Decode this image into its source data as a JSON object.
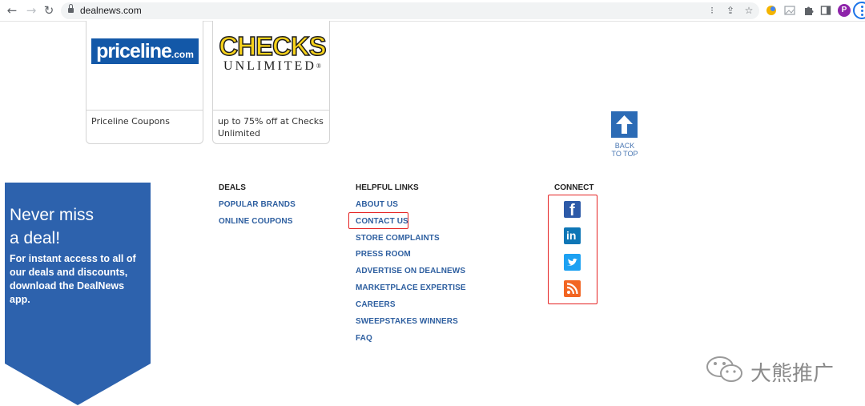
{
  "browser": {
    "url": "dealnews.com",
    "profile_initial": "P",
    "icons": [
      "back-icon",
      "forward-icon",
      "reload-icon",
      "lock-icon",
      "translate-icon",
      "share-icon",
      "bookmark-star-icon",
      "extension-icon",
      "puzzle-icon",
      "sidebar-icon",
      "kebab-menu-icon"
    ]
  },
  "cards": [
    {
      "logo": "priceline",
      "logo_main": "priceline",
      "logo_suffix": ".com",
      "caption": "Priceline Coupons"
    },
    {
      "logo": "checks",
      "logo_top": "CHECKS",
      "logo_bottom": "UNLIMITED",
      "logo_mark": "®",
      "caption": "up to 75% off at Checks Unlimited"
    }
  ],
  "back_to_top": {
    "label_line1": "BACK",
    "label_line2": "TO TOP"
  },
  "banner": {
    "title_line1": "Never miss",
    "title_line2": "a deal!",
    "subtitle": "For instant access to all of our deals and discounts, download the DealNews app.",
    "color": "#2d62ad"
  },
  "footer": {
    "deals": {
      "heading": "DEALS",
      "links": [
        "POPULAR BRANDS",
        "ONLINE COUPONS"
      ]
    },
    "helpful": {
      "heading": "HELPFUL LINKS",
      "links": [
        "ABOUT US",
        "CONTACT US",
        "STORE COMPLAINTS",
        "PRESS ROOM",
        "ADVERTISE ON DEALNEWS",
        "MARKETPLACE EXPERTISE",
        "CAREERS",
        "SWEEPSTAKES WINNERS",
        "FAQ"
      ]
    },
    "connect": {
      "heading": "CONNECT",
      "icons": [
        "facebook-icon",
        "linkedin-icon",
        "twitter-icon",
        "rss-icon"
      ]
    }
  },
  "watermark": {
    "text": "大熊推广"
  },
  "colors": {
    "link": "#2e5fa0",
    "accent_blue": "#2c6bb5",
    "highlight": "#e52222"
  }
}
